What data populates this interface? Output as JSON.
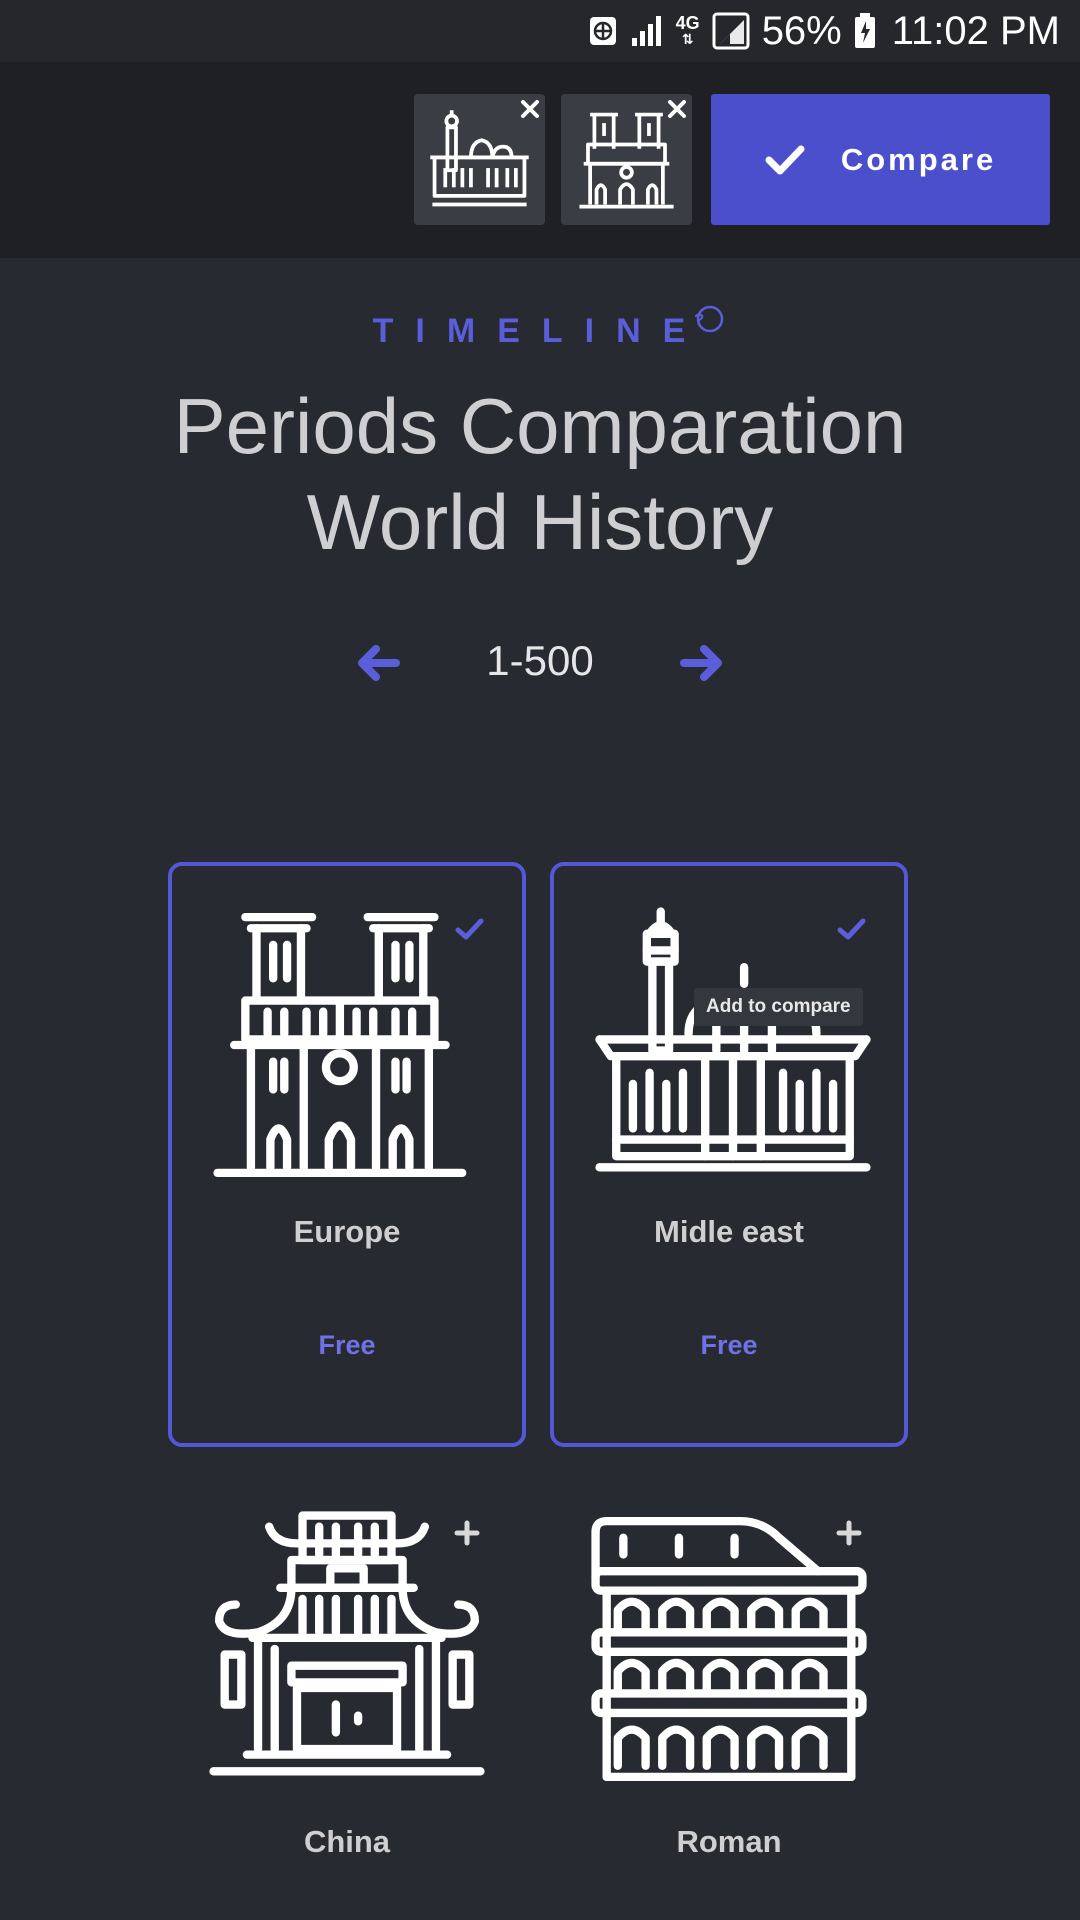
{
  "status_bar": {
    "battery_percent": "56%",
    "time": "11:02 PM",
    "network": "4G"
  },
  "compare_bar": {
    "thumbnails": [
      {
        "icon": "mosque-icon"
      },
      {
        "icon": "cathedral-icon"
      }
    ],
    "compare_label": "Compare"
  },
  "header": {
    "kicker": "TIMELINE",
    "title_line1": "Periods Comparation",
    "title_line2": "World History"
  },
  "pager": {
    "range_label": "1-500"
  },
  "cards": [
    {
      "name": "Europe",
      "price": "Free",
      "selected": true,
      "icon": "cathedral-icon"
    },
    {
      "name": "Midle east",
      "price": "Free",
      "selected": true,
      "icon": "mosque-icon",
      "tooltip": "Add to compare"
    },
    {
      "name": "China",
      "selected": false,
      "icon": "pagoda-icon"
    },
    {
      "name": "Roman",
      "selected": false,
      "icon": "colosseum-icon"
    }
  ],
  "colors": {
    "background": "#282a31",
    "accent": "#4b4fcc",
    "accent_text": "#6e72e6"
  }
}
